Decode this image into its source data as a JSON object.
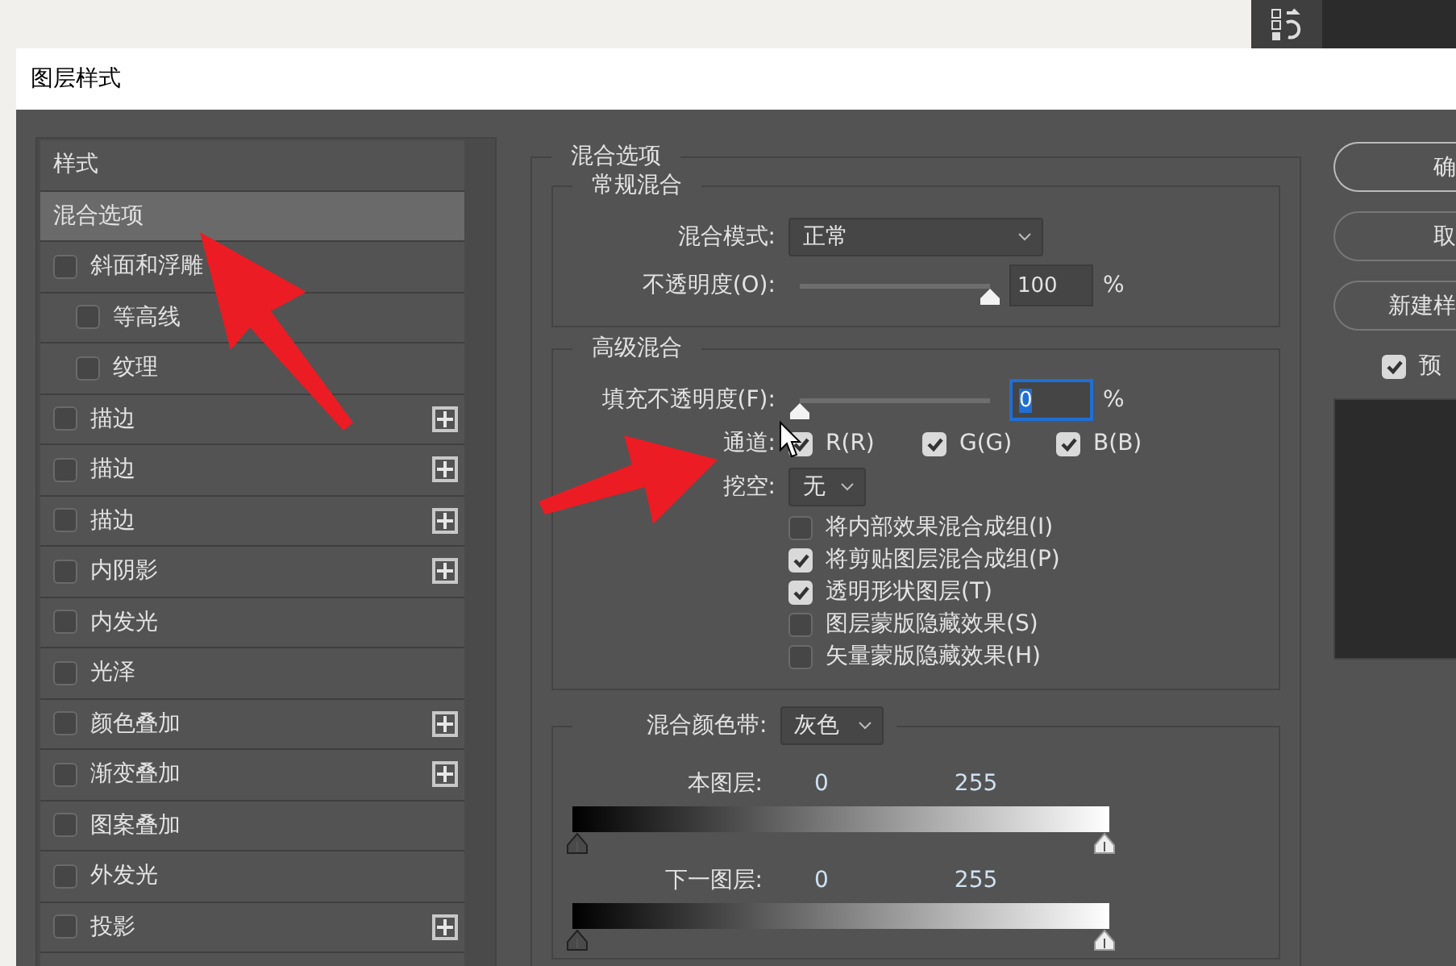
{
  "dialog": {
    "title": "图层样式"
  },
  "styles_panel": {
    "header": "样式",
    "items": [
      {
        "label": "混合选项",
        "kind": "heading",
        "selected": true
      },
      {
        "label": "斜面和浮雕",
        "kind": "check",
        "checked": false,
        "selected": false,
        "add": false
      },
      {
        "label": "等高线",
        "kind": "subcheck",
        "checked": false,
        "selected": false,
        "add": false
      },
      {
        "label": "纹理",
        "kind": "subcheck",
        "checked": false,
        "selected": false,
        "add": false
      },
      {
        "label": "描边",
        "kind": "check",
        "checked": false,
        "selected": false,
        "add": true
      },
      {
        "label": "描边",
        "kind": "check",
        "checked": false,
        "selected": false,
        "add": true
      },
      {
        "label": "描边",
        "kind": "check",
        "checked": false,
        "selected": false,
        "add": true
      },
      {
        "label": "内阴影",
        "kind": "check",
        "checked": false,
        "selected": false,
        "add": true
      },
      {
        "label": "内发光",
        "kind": "check",
        "checked": false,
        "selected": false,
        "add": false
      },
      {
        "label": "光泽",
        "kind": "check",
        "checked": false,
        "selected": false,
        "add": false
      },
      {
        "label": "颜色叠加",
        "kind": "check",
        "checked": false,
        "selected": false,
        "add": true
      },
      {
        "label": "渐变叠加",
        "kind": "check",
        "checked": false,
        "selected": false,
        "add": true
      },
      {
        "label": "图案叠加",
        "kind": "check",
        "checked": false,
        "selected": false,
        "add": false
      },
      {
        "label": "外发光",
        "kind": "check",
        "checked": false,
        "selected": false,
        "add": false
      },
      {
        "label": "投影",
        "kind": "check",
        "checked": false,
        "selected": false,
        "add": true
      }
    ]
  },
  "blending_options": {
    "legend": "混合选项",
    "general": {
      "legend": "常规混合",
      "mode": {
        "label": "混合模式:",
        "value": "正常"
      },
      "opacity": {
        "label": "不透明度(O):",
        "level": 1,
        "value": "100",
        "unit": "%",
        "focused": false
      }
    },
    "advanced": {
      "legend": "高级混合",
      "fill_opacity": {
        "label": "填充不透明度(F):",
        "level": 0,
        "value": "0",
        "unit": "%",
        "focused": true
      },
      "channels_label": "通道:",
      "channels": [
        {
          "label": "R(R)",
          "checked": true
        },
        {
          "label": "G(G)",
          "checked": true
        },
        {
          "label": "B(B)",
          "checked": true
        }
      ],
      "knockout": {
        "label": "挖空:",
        "value": "无"
      },
      "options": [
        {
          "label": "将内部效果混合成组(I)",
          "checked": false
        },
        {
          "label": "将剪贴图层混合成组(P)",
          "checked": true
        },
        {
          "label": "透明形状图层(T)",
          "checked": true
        },
        {
          "label": "图层蒙版隐藏效果(S)",
          "checked": false
        },
        {
          "label": "矢量蒙版隐藏效果(H)",
          "checked": false
        }
      ]
    },
    "blend_if": {
      "label": "混合颜色带:",
      "value": "灰色",
      "bands": [
        {
          "label": "本图层:",
          "low": "0",
          "high": "255"
        },
        {
          "label": "下一图层:",
          "low": "0",
          "high": "255"
        }
      ]
    }
  },
  "buttons": [
    {
      "label": "确"
    },
    {
      "label": "取"
    },
    {
      "label": "新建样"
    }
  ],
  "preview": {
    "label": "预",
    "checked": true
  }
}
